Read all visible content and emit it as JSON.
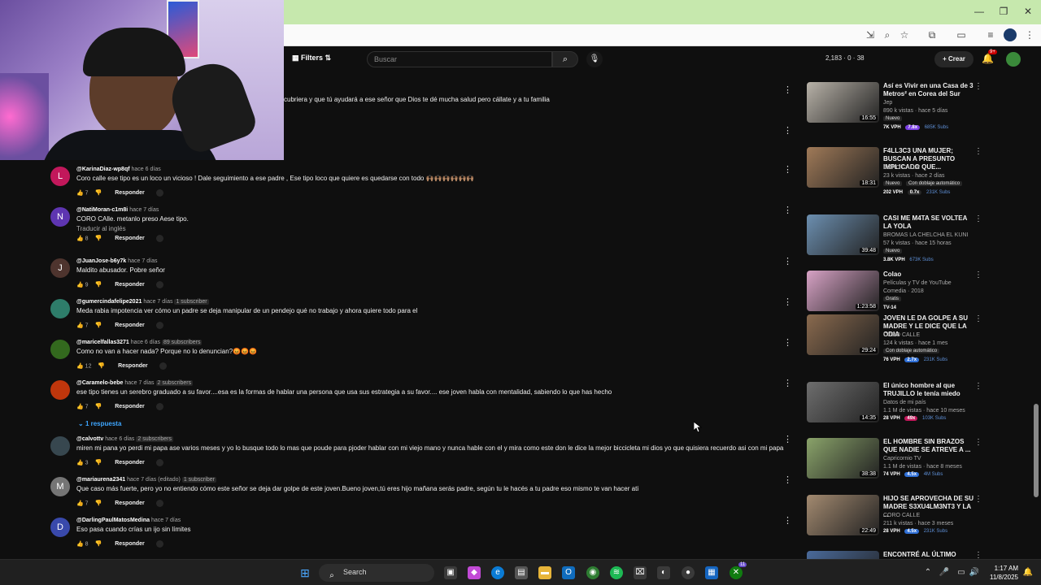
{
  "window": {
    "minimize": "—",
    "restore": "❐",
    "close": "✕"
  },
  "youtube_header": {
    "filters_label": "Filters",
    "search_placeholder": "Buscar",
    "stats": "2,183 · 0 · 38",
    "create_label": "Crear",
    "notification_badge": "9+"
  },
  "truncated_comment": "cubriera y que tú ayudará a ese señor que Dios te dé mucha salud pero cállate y a tu familia",
  "comments": [
    {
      "avatar_letter": "L",
      "avatar_color": "#c2185b",
      "user": "@KarinaDiaz-wp8qf",
      "time": "hace 6 días",
      "subscribers": "",
      "text": "Coro calle ese tipo es un loco un vicioso ! Dale seguimiento a ese padre , Ese tipo loco que quiere es quedarse con todo 🙌🏽🙌🏽🙌🏽🙌🏽🙌🏽🙌🏽",
      "translate": "",
      "likes": "7",
      "reply": "Responder"
    },
    {
      "avatar_letter": "N",
      "avatar_color": "#5e35b1",
      "user": "@NatiMoran-c1m8i",
      "time": "hace 7 días",
      "subscribers": "",
      "text": "CORO CAlle. metanlo preso Aese tipo.",
      "translate": "Traducir al inglés",
      "likes": "8",
      "reply": "Responder"
    },
    {
      "avatar_letter": "J",
      "avatar_color": "#4e342e",
      "user": "@JuanJose-b6y7k",
      "time": "hace 7 días",
      "subscribers": "",
      "text": "Maldito abusador. Pobre señor",
      "translate": "",
      "likes": "9",
      "reply": "Responder"
    },
    {
      "avatar_letter": "",
      "avatar_color": "#2e7d6a",
      "user": "@gumercindafelipe2021",
      "time": "hace 7 días",
      "subscribers": "1 subscriber",
      "text": "Meda rabia impotencia ver cómo un padre se deja manipular de un pendejo qué no trabajo y ahora quiere todo para el",
      "translate": "",
      "likes": "7",
      "reply": "Responder"
    },
    {
      "avatar_letter": "",
      "avatar_color": "#33691e",
      "user": "@maricelfallas3271",
      "time": "hace 6 días",
      "subscribers": "89 subscribers",
      "text": "Como no van a hacer nada? Porque no lo denuncian?😡😡😡",
      "translate": "",
      "likes": "12",
      "reply": "Responder"
    },
    {
      "avatar_letter": "",
      "avatar_color": "#bf360c",
      "user": "@Caramelo-bebe",
      "time": "hace 7 días",
      "subscribers": "2 subscribers",
      "text": "ese tipo tienes un serebro graduado a su favor....esa es la formas de hablar una persona que usa sus estrategia a su favor.... ese joven habla con mentalidad, sabiendo lo que has hecho",
      "translate": "",
      "likes": "7",
      "reply": "Responder"
    },
    {
      "avatar_letter": "",
      "avatar_color": "#37474f",
      "user": "@calvottv",
      "time": "hace 6 días",
      "subscribers": "2 subscribers",
      "text": "miren mi pana yo perdi mi papa ase varios meses y yo lo busque todo lo mas que poude para pjoder hablar con mi viejo mano y nunca hable con el y mira como este don le dice la mejor biccicleta mi dios yo que quisiera recuerdo asi con mi papa",
      "translate": "",
      "likes": "3",
      "reply": "Responder"
    },
    {
      "avatar_letter": "M",
      "avatar_color": "#757575",
      "user": "@mariaurena2341",
      "time": "hace 7 días (editado)",
      "subscribers": "1 subscriber",
      "text": "Que caso más fuerte, pero yo no entiendo cómo este señor se deja dar golpe de este joven.Bueno joven,tú eres hijo mañana serás padre, según tu le hacés a tu padre eso mismo te van hacer ati",
      "translate": "",
      "likes": "7",
      "reply": "Responder"
    },
    {
      "avatar_letter": "D",
      "avatar_color": "#3949ab",
      "user": "@DarlingPaulMatosMedina",
      "time": "hace 7 días",
      "subscribers": "",
      "text": "Eso pasa cuando crías un ijo sin límites",
      "translate": "",
      "likes": "8",
      "reply": "Responder"
    }
  ],
  "replies_toggle": "1 respuesta",
  "videos": [
    {
      "title": "Así es Vivir en una Casa de 3 Metros² en Corea del Sur",
      "channel": "Jep",
      "meta": "890 k vistas · hace 5 días",
      "tag": "Nuevo",
      "vph": "7K VPH",
      "mult": "7.8x",
      "mult_color": "#7b3fe4",
      "subs": "685K Subs",
      "duration": "16:55",
      "thumb_color": "#b8b2a8"
    },
    {
      "title": "F4LL3C3 UNA MUJER; BUSCAN A PRESUNTO IMPLICADO QUE...",
      "channel": "CORO CALLE",
      "meta": "23 k vistas · hace 2 días",
      "tag": "Nuevo",
      "tag2": "Con doblaje automático",
      "vph": "202 VPH",
      "mult": "0.7x",
      "mult_color": "#272727",
      "subs": "231K Subs",
      "duration": "18:31",
      "thumb_color": "#a07a58"
    },
    {
      "title": "CASI ME M4TA SE VOLTEA LA YOLA",
      "channel": "BROMAS LA CHELCHA EL KUNI",
      "meta": "57 k vistas · hace 15 horas",
      "tag": "Nuevo",
      "vph": "3.8K VPH",
      "mult": "",
      "mult_color": "#272727",
      "subs": "673K Subs",
      "duration": "39:48",
      "thumb_color": "#6c8fb0"
    },
    {
      "title": "Colao",
      "channel": "Películas y TV de YouTube",
      "meta": "Comedia · 2018",
      "tag": "Gratis",
      "vph": "TV-14",
      "mult": "",
      "mult_color": "#272727",
      "subs": "",
      "duration": "1:23:58",
      "thumb_color": "#d7a2c5"
    },
    {
      "title": "JOVEN LE DA GOLPE A SU MADRE Y LE DICE QUE LA ODIA",
      "channel": "CORO CALLE",
      "meta": "124 k vistas · hace 1 mes",
      "tag": "Con doblaje automático",
      "vph": "76 VPH",
      "mult": "2.7x",
      "mult_color": "#2f6fd6",
      "subs": "231K Subs",
      "duration": "29:24",
      "thumb_color": "#8a6a4e"
    },
    {
      "title": "El único hombre al que TRUJILLO le tenía miedo",
      "channel": "Datos de mi país",
      "meta": "1.1 M de vistas · hace 10 meses",
      "tag": "",
      "vph": "28 VPH",
      "mult": "49x",
      "mult_color": "#c2185b",
      "subs": "103K Subs",
      "duration": "14:35",
      "thumb_color": "#6e6e6e"
    },
    {
      "title": "EL HOMBRE SIN BRAZOS QUE NADIE SE ATREVE A ...",
      "channel": "Capricornio TV",
      "meta": "1.1 M de vistas · hace 8 meses",
      "tag": "",
      "vph": "74 VPH",
      "mult": "4.5x",
      "mult_color": "#2f6fd6",
      "subs": "4M Subs",
      "duration": "38:38",
      "thumb_color": "#8aa36a"
    },
    {
      "title": "HIJO SE APROVECHA DE SU MADRE S3XU4LM3NT3 Y LA ...",
      "channel": "CORO CALLE",
      "meta": "211 k vistas · hace 3 meses",
      "tag": "",
      "vph": "28 VPH",
      "mult": "4.5x",
      "mult_color": "#2f6fd6",
      "subs": "231K Subs",
      "duration": "22:49",
      "thumb_color": "#a38a70"
    },
    {
      "title": "ENCONTRÉ AL ÚLTIMO NINJA",
      "channel": "",
      "meta": "",
      "tag": "",
      "vph": "",
      "mult": "",
      "mult_color": "#272727",
      "subs": "",
      "duration": "",
      "thumb_color": "#4a6a9a"
    }
  ],
  "taskbar": {
    "search_label": "Search",
    "time": "1:17 AM",
    "date": "11/8/2025",
    "notif_count": "11"
  }
}
